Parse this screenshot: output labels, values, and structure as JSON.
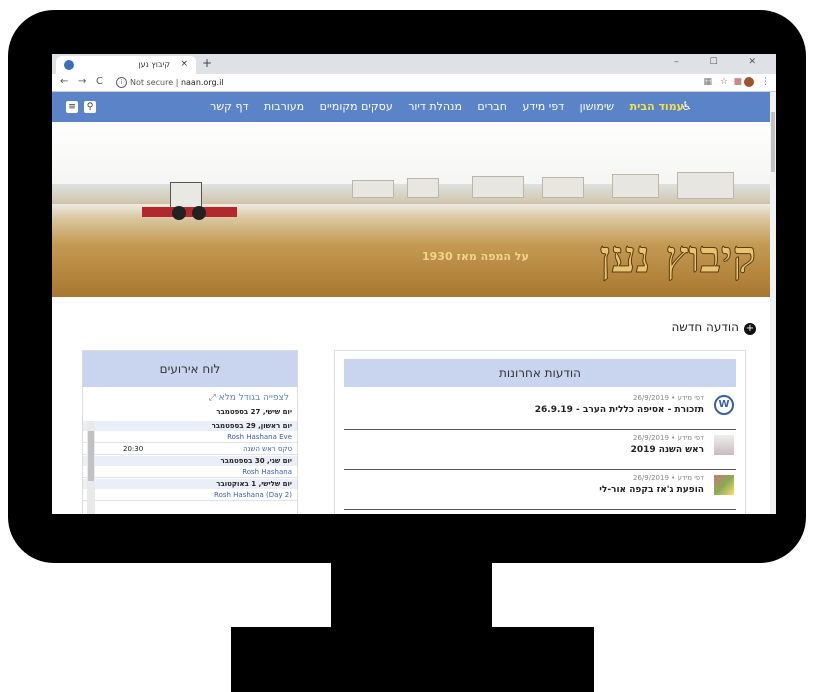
{
  "browser": {
    "tab_title": "קיבוץ נען",
    "tab_close": "×",
    "new_tab": "+",
    "window_controls": "–  ☐  ✕",
    "nav": {
      "back": "←",
      "forward": "→",
      "reload": "C"
    },
    "security_label": "Not secure",
    "url": "naan.org.il"
  },
  "site": {
    "nav_items": [
      "עמוד הבית",
      "שימושון",
      "דפי מידע",
      "חברים",
      "מנהלת דיור",
      "עסקים מקומיים",
      "מעורבות",
      "דף קשר"
    ],
    "accessibility_icon": "♿",
    "hero": {
      "title": "קיבוץ נען",
      "subtitle": "על המפה מאז 1930"
    },
    "new_post": "הודעה חדשה",
    "posts_panel": {
      "title": "הודעות אחרונות",
      "posts": [
        {
          "meta": "דפי מידע • 26/9/2019",
          "title": "תזכורת - אסיפה כללית הערב - 26.9.19"
        },
        {
          "meta": "דפי מידע • 26/9/2019",
          "title": "ראש השנה 2019"
        },
        {
          "meta": "דפי מידע • 26/9/2019",
          "title": "הופעת ג'אז בקפה אור-לי"
        }
      ]
    },
    "events_panel": {
      "title": "לוח אירועים",
      "full_view": "לצפייה בגודל מלא",
      "rows": [
        {
          "kind": "plain",
          "text": "יום שישי, 27 בספטמבר"
        },
        {
          "kind": "date",
          "text": "יום ראשון, 29 בספטמבר"
        },
        {
          "kind": "item",
          "text": "Rosh Hashana Eve"
        },
        {
          "kind": "item",
          "text": "טקס ראש השנה",
          "time": "20:30"
        },
        {
          "kind": "date",
          "text": "יום שני, 30 בספטמבר"
        },
        {
          "kind": "item",
          "text": "Rosh Hashana"
        },
        {
          "kind": "date",
          "text": "יום שלישי, 1 באוקטובר"
        },
        {
          "kind": "item",
          "text": "Rosh Hashana (Day 2)"
        }
      ]
    }
  },
  "colors": {
    "nav_bar": "#5b83c7",
    "nav_active": "#f4e04d",
    "panel_header": "#c9d5ef"
  }
}
